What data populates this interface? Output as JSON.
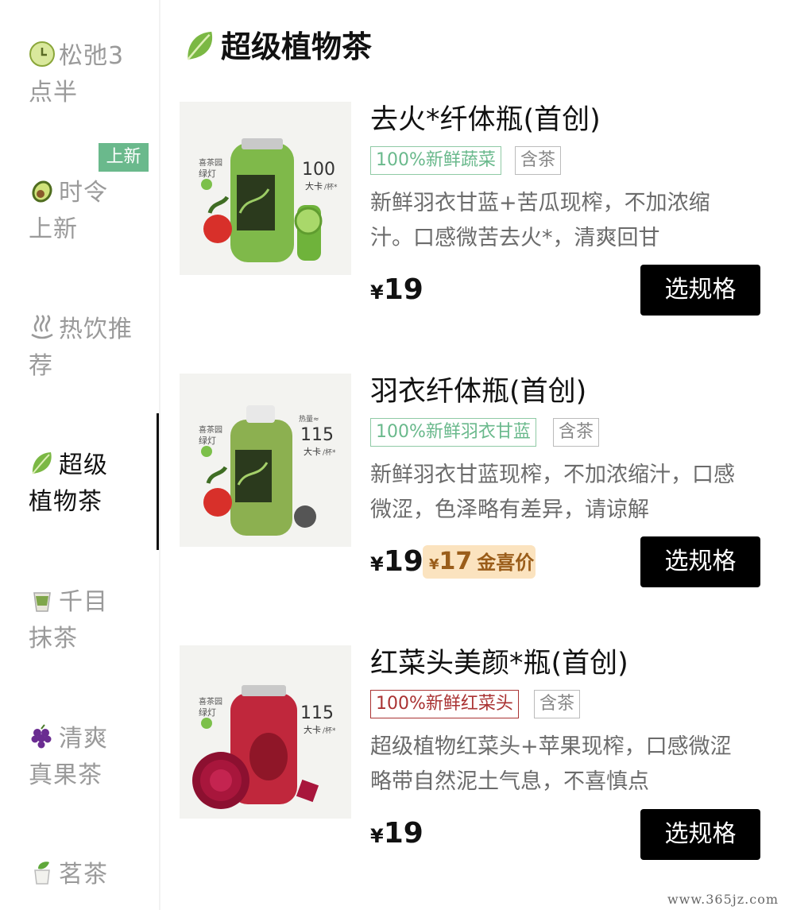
{
  "sidebar": {
    "items": [
      {
        "line1": "松弛3",
        "line2": "点半",
        "icon": "clock-icon",
        "active": false
      },
      {
        "line1": "时令",
        "line2": "上新",
        "icon": "avocado-icon",
        "active": false,
        "badge": "上新"
      },
      {
        "line1": "热饮推",
        "line2": "荐",
        "icon": "hot-springs-icon",
        "active": false
      },
      {
        "line1": "超级",
        "line2": "植物茶",
        "icon": "leafy-green-icon",
        "active": true
      },
      {
        "line1": "千目",
        "line2": "抹茶",
        "icon": "matcha-cup-icon",
        "active": false
      },
      {
        "line1": "清爽",
        "line2": "真果茶",
        "icon": "grapes-icon",
        "active": false
      },
      {
        "line1": "茗茶",
        "line2": "",
        "icon": "tea-leaf-icon",
        "active": false
      }
    ]
  },
  "section": {
    "title": "超级植物茶",
    "icon": "leafy-green-icon"
  },
  "products": [
    {
      "name": "去火*纤体瓶(首创)",
      "tag1": "100%新鲜蔬菜",
      "tag2": "含茶",
      "desc1": "新鲜羽衣甘蓝+苦瓜现榨，不加浓缩",
      "desc2": "汁。口感微苦去火*，清爽回甘",
      "price_symbol": "¥",
      "price": "19",
      "button": "选规格",
      "img": {
        "brand": "喜茶园",
        "brand2": "绿灯",
        "kcal": "100",
        "kcal_unit": "大卡",
        "kcal_per": "/杯*",
        "bottle_color": "#7fb94a"
      }
    },
    {
      "name": "羽衣纤体瓶(首创)",
      "tag1": "100%新鲜羽衣甘蓝",
      "tag2": "含茶",
      "desc1": "新鲜羽衣甘蓝现榨，不加浓缩汁，口感",
      "desc2": "微涩，色泽略有差异，请谅解",
      "price_symbol": "¥",
      "price": "19",
      "vip_symbol": "¥",
      "vip_price": "17",
      "vip_label": "金喜价",
      "button": "选规格",
      "img": {
        "brand": "喜茶园",
        "brand2": "绿灯",
        "kcal_head": "热量≈",
        "kcal": "115",
        "kcal_unit": "大卡",
        "kcal_per": "/杯*",
        "bottle_color": "#8cb050"
      }
    },
    {
      "name": "红菜头美颜*瓶(首创)",
      "tag1": "100%新鲜红菜头",
      "tag2": "含茶",
      "desc1": "超级植物红菜头+苹果现榨，口感微涩",
      "desc2": "略带自然泥土气息，不喜慎点",
      "price_symbol": "¥",
      "price": "19",
      "button": "选规格",
      "img": {
        "brand": "喜茶园",
        "brand2": "绿灯",
        "kcal": "115",
        "kcal_unit": "大卡",
        "kcal_per": "/杯*",
        "bottle_color": "#c0273c"
      }
    }
  ],
  "watermark": "www.365jz.com",
  "colors": {
    "accent_green": "#6ab98c",
    "button_black": "#000000",
    "vip_bg": "#fbe3bf",
    "vip_text": "#9a5d1a"
  }
}
